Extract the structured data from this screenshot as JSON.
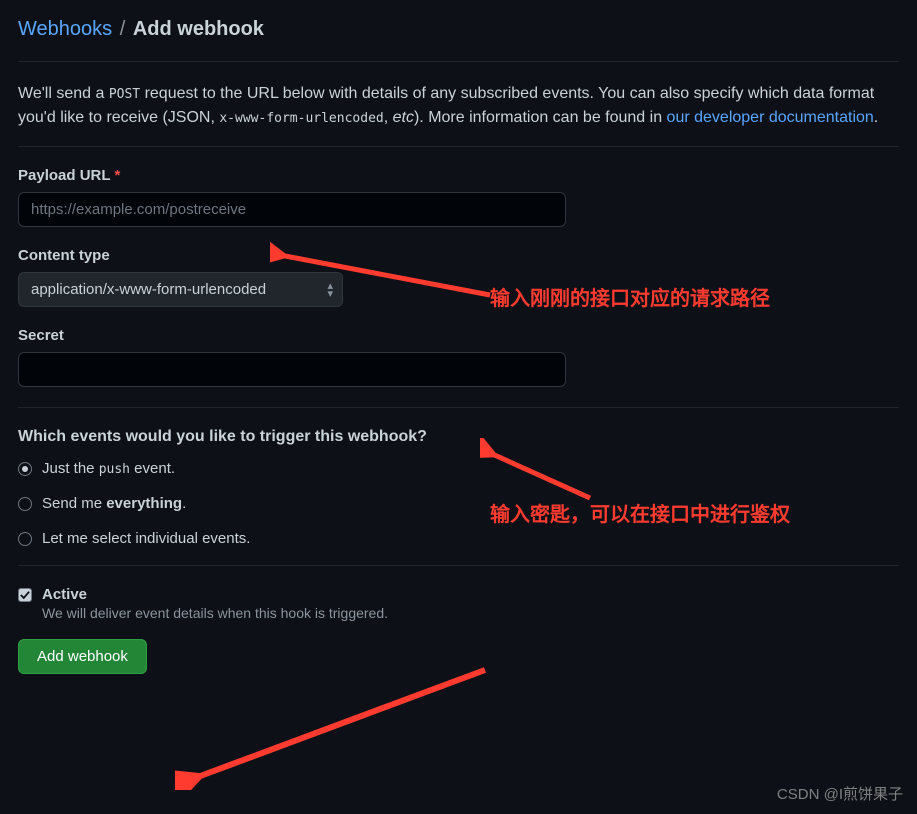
{
  "breadcrumb": {
    "parent": "Webhooks",
    "separator": "/",
    "current": "Add webhook"
  },
  "intro": {
    "t1": "We'll send a ",
    "post": "POST",
    "t2": " request to the URL below with details of any subscribed events. You can also specify which data format you'd like to receive (JSON, ",
    "form": "x-www-form-urlencoded",
    "t3": ", ",
    "etc": "etc",
    "t4": "). More information can be found in ",
    "link": "our developer documentation",
    "t5": "."
  },
  "payload": {
    "label": "Payload URL",
    "required": "*",
    "placeholder": "https://example.com/postreceive"
  },
  "contentType": {
    "label": "Content type",
    "value": "application/x-www-form-urlencoded"
  },
  "secret": {
    "label": "Secret",
    "value": ""
  },
  "events": {
    "heading": "Which events would you like to trigger this webhook?",
    "opt1_a": "Just the ",
    "opt1_code": "push",
    "opt1_b": " event.",
    "opt2_a": "Send me ",
    "opt2_strong": "everything",
    "opt2_b": ".",
    "opt3": "Let me select individual events."
  },
  "active": {
    "label": "Active",
    "desc": "We will deliver event details when this hook is triggered."
  },
  "submit": {
    "label": "Add webhook"
  },
  "annotations": {
    "a1": "输入刚刚的接口对应的请求路径",
    "a2": "输入密匙，可以在接口中进行鉴权"
  },
  "watermark": "CSDN @I煎饼果子"
}
